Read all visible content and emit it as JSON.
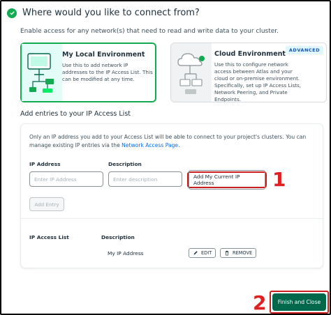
{
  "header": {
    "title": "Where would you like to connect from?",
    "subtitle": "Enable access for any network(s) that need to read and write data to your cluster."
  },
  "cards": {
    "local": {
      "title": "My Local Environment",
      "description": "Use this to add network IP addresses to the IP Access List. This can be modified at any time."
    },
    "cloud": {
      "title": "Cloud Environment",
      "badge": "ADVANCED",
      "description": "Use this to configure network access between Atlas and your cloud or on-premise environment. Specifically, set up IP Access Lists, Network Peering, and Private Endpoints."
    }
  },
  "access_list": {
    "section_title": "Add entries to your IP Access List",
    "intro_text": "Only an IP address you add to your Access List will be able to connect to your project's clusters. You can manage existing IP entries via the ",
    "intro_link": "Network Access Page",
    "intro_end": ".",
    "ip_label": "IP Address",
    "ip_placeholder": "Enter IP Address",
    "desc_label": "Description",
    "desc_placeholder": "Enter description",
    "add_current_label": "Add My Current IP Address",
    "add_entry_label": "Add Entry",
    "table": {
      "headers": [
        "IP Access List",
        "Description"
      ],
      "rows": [
        {
          "ip": "",
          "description": "My IP Address",
          "edit_label": "EDIT",
          "remove_label": "REMOVE"
        }
      ]
    }
  },
  "annotations": {
    "step1": "1",
    "step2": "2"
  },
  "footer": {
    "finish_label": "Finish and Close"
  },
  "colors": {
    "brand_green": "#13aa52",
    "button_green": "#00684a",
    "highlight_red": "#cc1d1d",
    "link_blue": "#016bf8"
  }
}
